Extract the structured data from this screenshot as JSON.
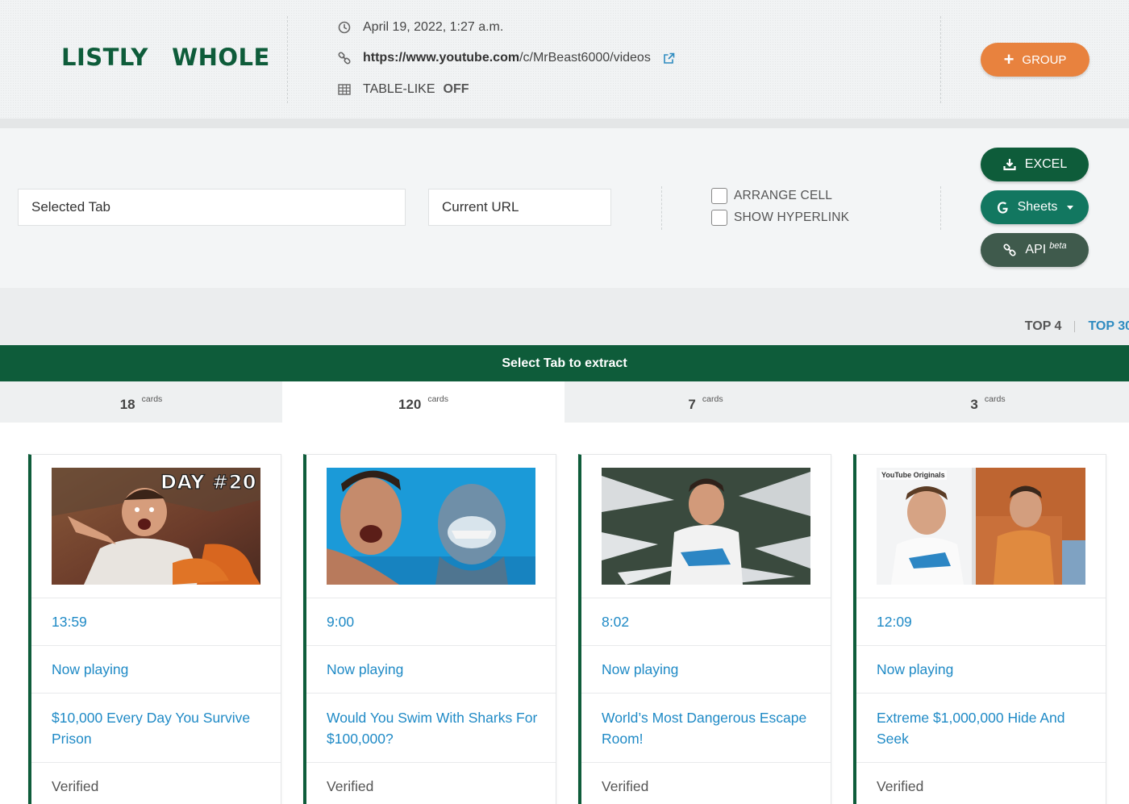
{
  "header": {
    "logo": "LISTLY  WHOLE",
    "timestamp": "April 19, 2022, 1:27 a.m.",
    "url_bold": "https://www.youtube.com",
    "url_rest": "/c/MrBeast6000/videos",
    "table_like_label": "TABLE-LIKE",
    "table_like_value": "OFF",
    "group_button": "GROUP"
  },
  "controls": {
    "selected_tab": "Selected Tab",
    "current_url": "Current URL",
    "arrange_cell": "ARRANGE CELL",
    "show_hyperlink": "SHOW HYPERLINK",
    "excel": "EXCEL",
    "sheets": "Sheets",
    "api": "API",
    "api_badge": "beta"
  },
  "top_links": {
    "top4": "TOP 4",
    "top30": "TOP 30"
  },
  "tab_bar": {
    "title": "Select Tab to extract",
    "tabs": [
      {
        "count": "18",
        "label": "cards",
        "active": false
      },
      {
        "count": "120",
        "label": "cards",
        "active": true
      },
      {
        "count": "7",
        "label": "cards",
        "active": false
      },
      {
        "count": "3",
        "label": "cards",
        "active": false
      }
    ]
  },
  "cards": [
    {
      "duration": "13:59",
      "status": "Now playing",
      "title": "$10,000 Every Day You Survive Prison",
      "badge": "Verified",
      "thumb_text": "DAY #20"
    },
    {
      "duration": "9:00",
      "status": "Now playing",
      "title": "Would You Swim With Sharks For $100,000?",
      "badge": "Verified"
    },
    {
      "duration": "8:02",
      "status": "Now playing",
      "title": "World’s Most Dangerous Escape Room!",
      "badge": "Verified"
    },
    {
      "duration": "12:09",
      "status": "Now playing",
      "title": "Extreme $1,000,000 Hide And Seek",
      "badge": "Verified",
      "thumb_text": "YouTube Originals"
    }
  ],
  "colors": {
    "brand_green": "#0e5c3a",
    "accent_orange": "#e8823e",
    "link_blue": "#1f8ac6",
    "sheets_green": "#127760",
    "api_gray_green": "#3f5a4c"
  },
  "icons": [
    "clock-icon",
    "link-icon",
    "external-link-icon",
    "table-icon",
    "plus-icon",
    "download-icon",
    "google-icon",
    "link-icon"
  ]
}
